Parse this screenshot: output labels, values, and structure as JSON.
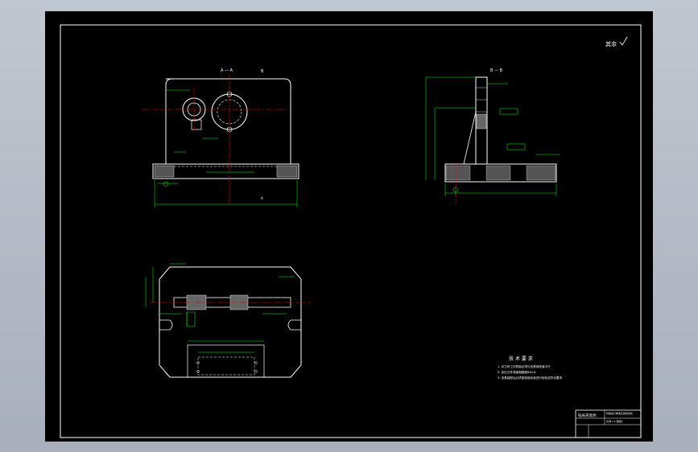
{
  "drawing": {
    "roughness_note": "其余",
    "section_aa": "A — A",
    "section_bb": "B — B",
    "view_marker_a": "A",
    "view_marker_b": "B",
    "tech_requirements": {
      "title": "技 术 要 求",
      "items": [
        "1. 对刀块工作表面必须与夹具体底面平行",
        "2. 定位元件表面粗糙度Ra0.8",
        "3. 夹具装配后必须按检验标准进行检验并符合要求"
      ]
    },
    "title_block": {
      "name": "钻床夹具体",
      "school_cell": "机械设计制造及其自动化",
      "sub_cell": "比例 1:1 数量1"
    }
  },
  "colors": {
    "background": "#000000",
    "outline": "#ffffff",
    "dimension": "#00ff00",
    "centerline": "#ff0000",
    "note": "#ffff00",
    "frame_bg": "#b8c0ca"
  }
}
